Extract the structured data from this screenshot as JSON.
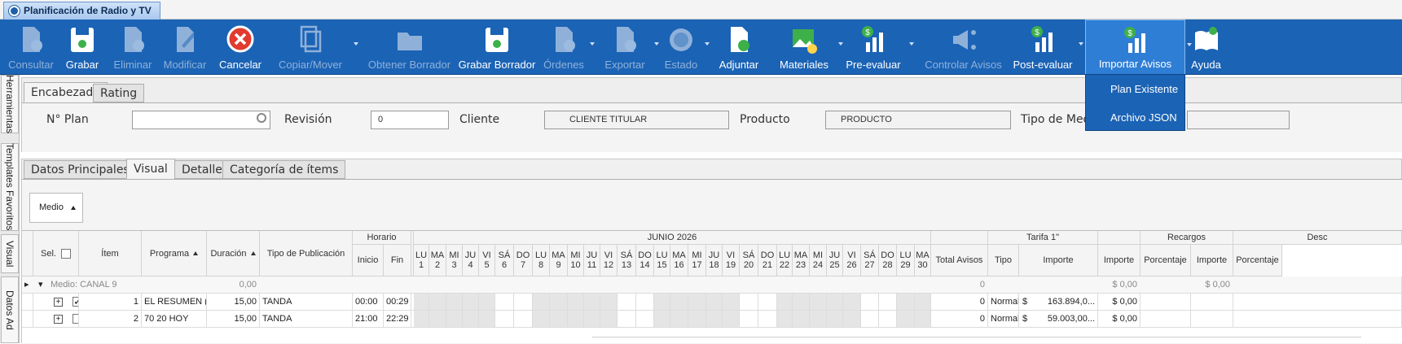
{
  "window": {
    "title": "Planificación de Radio y TV"
  },
  "ribbon": {
    "buttons": [
      {
        "label": "Consultar",
        "icon": "search-doc-icon",
        "enabled": false
      },
      {
        "label": "Grabar",
        "icon": "save-icon",
        "enabled": true
      },
      {
        "label": "Eliminar",
        "icon": "delete-doc-icon",
        "enabled": false
      },
      {
        "label": "Modificar",
        "icon": "edit-icon",
        "enabled": false
      },
      {
        "label": "Cancelar",
        "icon": "cancel-icon",
        "enabled": true
      },
      {
        "label": "Copiar/Mover",
        "icon": "copy-icon",
        "enabled": false
      },
      {
        "label": "Obtener Borrador",
        "icon": "folder-icon",
        "enabled": false
      },
      {
        "label": "Grabar Borrador",
        "icon": "save-draft-icon",
        "enabled": true
      },
      {
        "label": "Órdenes",
        "icon": "orders-icon",
        "enabled": false
      },
      {
        "label": "Exportar",
        "icon": "export-icon",
        "enabled": false
      },
      {
        "label": "Estado",
        "icon": "status-icon",
        "enabled": false
      },
      {
        "label": "Adjuntar",
        "icon": "attach-icon",
        "enabled": true
      },
      {
        "label": "Materiales",
        "icon": "materials-icon",
        "enabled": true
      },
      {
        "label": "Pre-evaluar",
        "icon": "chart-money-icon",
        "enabled": true
      },
      {
        "label": "Controlar Avisos",
        "icon": "megaphone-icon",
        "enabled": false
      },
      {
        "label": "Post-evaluar",
        "icon": "chart-money-icon",
        "enabled": true
      },
      {
        "label": "Importar Avisos",
        "icon": "chart-money-icon",
        "enabled": true,
        "active": true
      },
      {
        "label": "Ayuda",
        "icon": "help-book-icon",
        "enabled": true
      }
    ],
    "dropdown": [
      "Plan Existente",
      "Archivo JSON"
    ]
  },
  "side_tabs": [
    "Herramientas",
    "Templates Favoritos",
    "Visual",
    "Datos Ad"
  ],
  "header_tabs": [
    "Encabezado",
    "Rating"
  ],
  "header": {
    "plan_label": "N° Plan",
    "plan_value": "",
    "revision_label": "Revisión",
    "revision_value": "0",
    "cliente_label": "Cliente",
    "cliente_value": "CLIENTE TITULAR",
    "producto_label": "Producto",
    "producto_value": "PRODUCTO",
    "tipo_label": "Tipo de Med"
  },
  "detail_tabs": [
    "Datos Principales",
    "Visual",
    "Detalle",
    "Categoría de ítems"
  ],
  "medio_button": "Medio",
  "grid": {
    "group_horario": "Horario",
    "group_month": "JUNIO 2026",
    "group_tarifa": "Tarifa 1\"",
    "group_recargos": "Recargos",
    "group_desc": "Desc",
    "cols": {
      "sel": "Sel.",
      "item": "Ítem",
      "programa": "Programa",
      "duracion": "Duración",
      "tipo_pub": "Tipo de Publicación",
      "inicio": "Inicio",
      "fin": "Fin",
      "total": "Total Avisos",
      "tipo": "Tipo",
      "importe": "Importe",
      "importe2": "Importe",
      "porcentaje": "Porcentaje",
      "importe3": "Importe",
      "porcentaje2": "Porcentaje"
    },
    "days": [
      [
        "LU",
        "1"
      ],
      [
        "MA",
        "2"
      ],
      [
        "MI",
        "3"
      ],
      [
        "JU",
        "4"
      ],
      [
        "VI",
        "5"
      ],
      [
        "SÁ",
        "6"
      ],
      [
        "DO",
        "7"
      ],
      [
        "LU",
        "8"
      ],
      [
        "MA",
        "9"
      ],
      [
        "MI",
        "10"
      ],
      [
        "JU",
        "11"
      ],
      [
        "VI",
        "12"
      ],
      [
        "SÁ",
        "13"
      ],
      [
        "DO",
        "14"
      ],
      [
        "LU",
        "15"
      ],
      [
        "MA",
        "16"
      ],
      [
        "MI",
        "17"
      ],
      [
        "JU",
        "18"
      ],
      [
        "VI",
        "19"
      ],
      [
        "SÁ",
        "20"
      ],
      [
        "DO",
        "21"
      ],
      [
        "LU",
        "22"
      ],
      [
        "MA",
        "23"
      ],
      [
        "MI",
        "24"
      ],
      [
        "JU",
        "25"
      ],
      [
        "VI",
        "26"
      ],
      [
        "SÁ",
        "27"
      ],
      [
        "DO",
        "28"
      ],
      [
        "LU",
        "29"
      ],
      [
        "MA",
        "30"
      ]
    ],
    "group_row": {
      "label": "Medio: CANAL 9",
      "duracion": "0,00",
      "total": "0",
      "importe2": "$ 0,00",
      "importe3": "$ 0,00"
    },
    "rows": [
      {
        "checked": true,
        "item": "1",
        "programa": "EL RESUMEN (D)",
        "duracion": "15,00",
        "tipo_pub": "TANDA",
        "inicio": "00:00",
        "fin": "00:29",
        "total": "0",
        "tipo": "Normal",
        "currency": "$",
        "importe": "163.894,0...",
        "importe2": "$ 0,00",
        "shaded_days": [
          1,
          2,
          3,
          4,
          5,
          8,
          9,
          10,
          11,
          12,
          15,
          16,
          17,
          18,
          19,
          22,
          23,
          24,
          25,
          26,
          29,
          30
        ]
      },
      {
        "checked": false,
        "item": "2",
        "programa": "70 20 HOY",
        "duracion": "15,00",
        "tipo_pub": "TANDA",
        "inicio": "21:00",
        "fin": "22:29",
        "total": "0",
        "tipo": "Normal",
        "currency": "$",
        "importe": "59.003,00...",
        "importe2": "$ 0,00",
        "shaded_days": [
          1,
          2,
          3,
          4,
          5,
          8,
          9,
          10,
          11,
          12,
          15,
          16,
          17,
          18,
          19,
          22,
          23,
          24,
          25,
          26,
          29,
          30
        ]
      }
    ]
  }
}
